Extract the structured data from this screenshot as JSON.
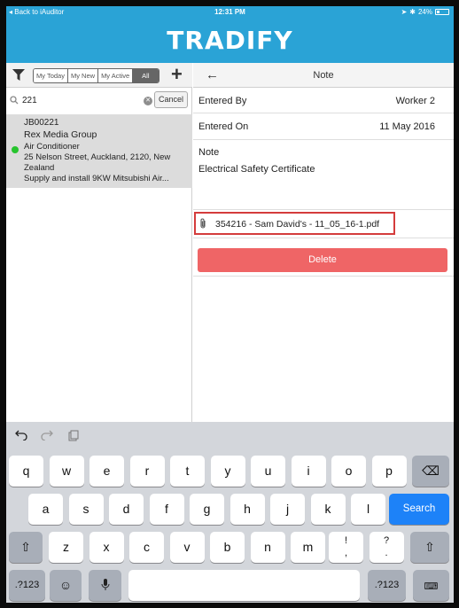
{
  "status_bar": {
    "back_label": "Back to iAuditor",
    "time": "12:31 PM",
    "battery": "24%",
    "battery_level": 0.24
  },
  "header": {
    "logo": "TRADIFY",
    "brand_color": "#2aa3d6"
  },
  "left_pane": {
    "segments": [
      "My Today",
      "My New",
      "My Active",
      "All"
    ],
    "active_segment": "All",
    "add_icon": "plus-icon",
    "filter_icon": "funnel-icon",
    "search": {
      "value": "221",
      "cancel_label": "Cancel"
    },
    "job": {
      "number": "JB00221",
      "client": "Rex Media Group",
      "type": "Air Conditioner",
      "address_line1": "25 Nelson Street, Auckland, 2120, New",
      "address_line2": "Zealand",
      "description": "Supply and install 9KW Mitsubishi Air...",
      "status_color": "#27c42e"
    }
  },
  "right_pane": {
    "title": "Note",
    "fields": [
      {
        "label": "Entered By",
        "value": "Worker 2"
      },
      {
        "label": "Entered On",
        "value": "11 May 2016"
      }
    ],
    "note_label": "Note",
    "note_text": "Electrical Safety Certificate",
    "attachment": "354216 - Sam David's - 11_05_16-1.pdf",
    "delete_label": "Delete",
    "delete_color": "#ef6566"
  },
  "keyboard": {
    "row1": [
      "q",
      "w",
      "e",
      "r",
      "t",
      "y",
      "u",
      "i",
      "o",
      "p"
    ],
    "row2": [
      "a",
      "s",
      "d",
      "f",
      "g",
      "h",
      "j",
      "k",
      "l"
    ],
    "row3": [
      "z",
      "x",
      "c",
      "v",
      "b",
      "n",
      "m"
    ],
    "row3_punct": [
      {
        "top": "!",
        "bottom": ","
      },
      {
        "top": "?",
        "bottom": "."
      }
    ],
    "search_label": "Search",
    "numbers_label": ".?123"
  }
}
